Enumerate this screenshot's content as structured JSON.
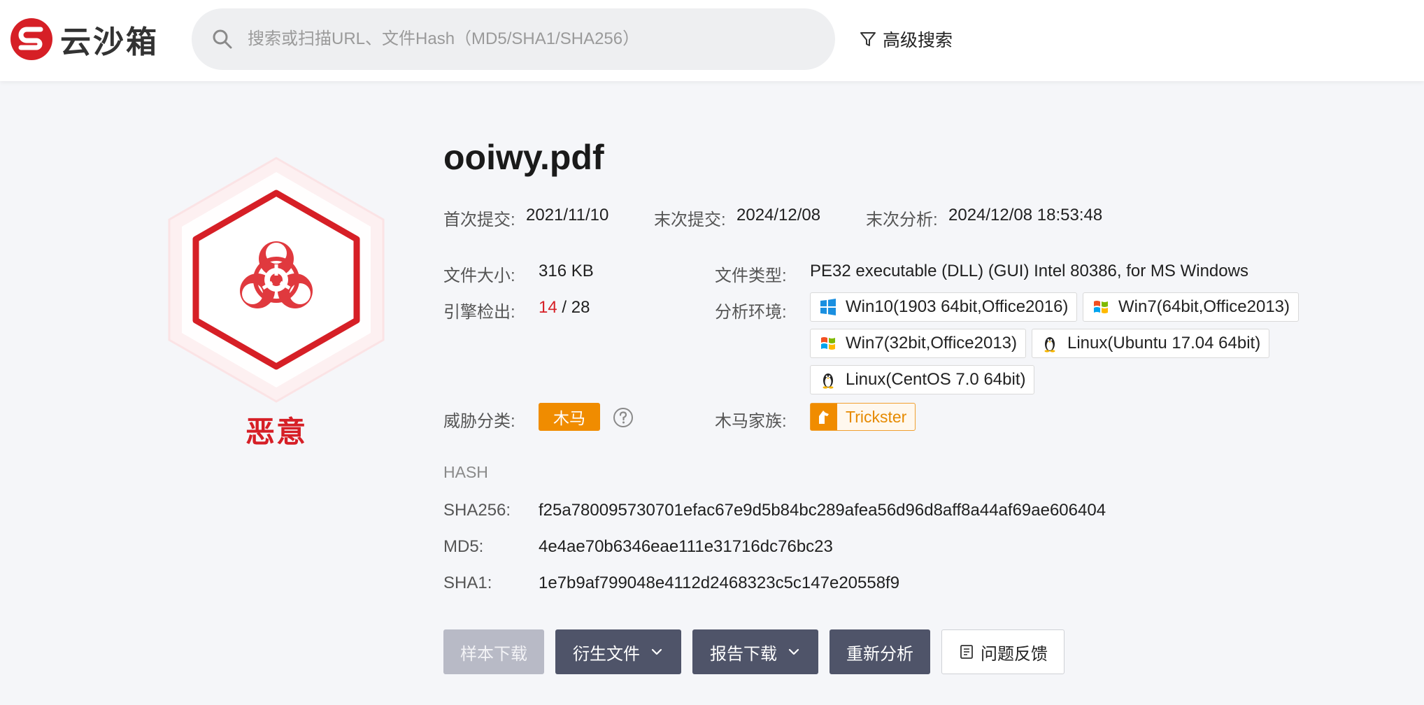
{
  "header": {
    "logo_text": "云沙箱",
    "search_placeholder": "搜索或扫描URL、文件Hash（MD5/SHA1/SHA256）",
    "advanced_search": "高级搜索"
  },
  "verdict": {
    "label": "恶意",
    "icon": "biohazard-icon",
    "color": "#d61f26"
  },
  "file": {
    "name": "ooiwy.pdf",
    "first_submit_label": "首次提交:",
    "first_submit": "2021/11/10",
    "last_submit_label": "末次提交:",
    "last_submit": "2024/12/08",
    "last_analysis_label": "末次分析:",
    "last_analysis": "2024/12/08 18:53:48",
    "size_label": "文件大小:",
    "size": "316 KB",
    "type_label": "文件类型:",
    "type": "PE32 executable (DLL) (GUI) Intel 80386, for MS Windows",
    "detect_label": "引擎检出:",
    "detect_hits": "14",
    "detect_sep": " / ",
    "detect_total": "28",
    "env_label": "分析环境:",
    "environments": [
      {
        "icon": "windows10-icon",
        "label": "Win10(1903 64bit,Office2016)"
      },
      {
        "icon": "windows7-icon",
        "label": "Win7(64bit,Office2013)"
      },
      {
        "icon": "windows7-icon",
        "label": "Win7(32bit,Office2013)"
      },
      {
        "icon": "linux-penguin-icon",
        "label": "Linux(Ubuntu 17.04 64bit)"
      },
      {
        "icon": "linux-penguin-icon",
        "label": "Linux(CentOS 7.0 64bit)"
      }
    ],
    "threat_label": "威胁分类:",
    "threat_tag": "木马",
    "family_label": "木马家族:",
    "family": "Trickster"
  },
  "hash": {
    "heading": "HASH",
    "sha256_label": "SHA256:",
    "sha256": "f25a780095730701efac67e9d5b84bc289afea56d96d8aff8a44af69ae606404",
    "md5_label": "MD5:",
    "md5": "4e4ae70b6346eae111e31716dc76bc23",
    "sha1_label": "SHA1:",
    "sha1": "1e7b9af799048e4112d2468323c5c147e20558f9"
  },
  "actions": {
    "download_sample": "样本下载",
    "derived_files": "衍生文件",
    "download_report": "报告下载",
    "reanalyze": "重新分析",
    "feedback": "问题反馈"
  },
  "colors": {
    "brand_red": "#d61f26",
    "orange": "#f08c00",
    "dark_button": "#4f5469"
  }
}
